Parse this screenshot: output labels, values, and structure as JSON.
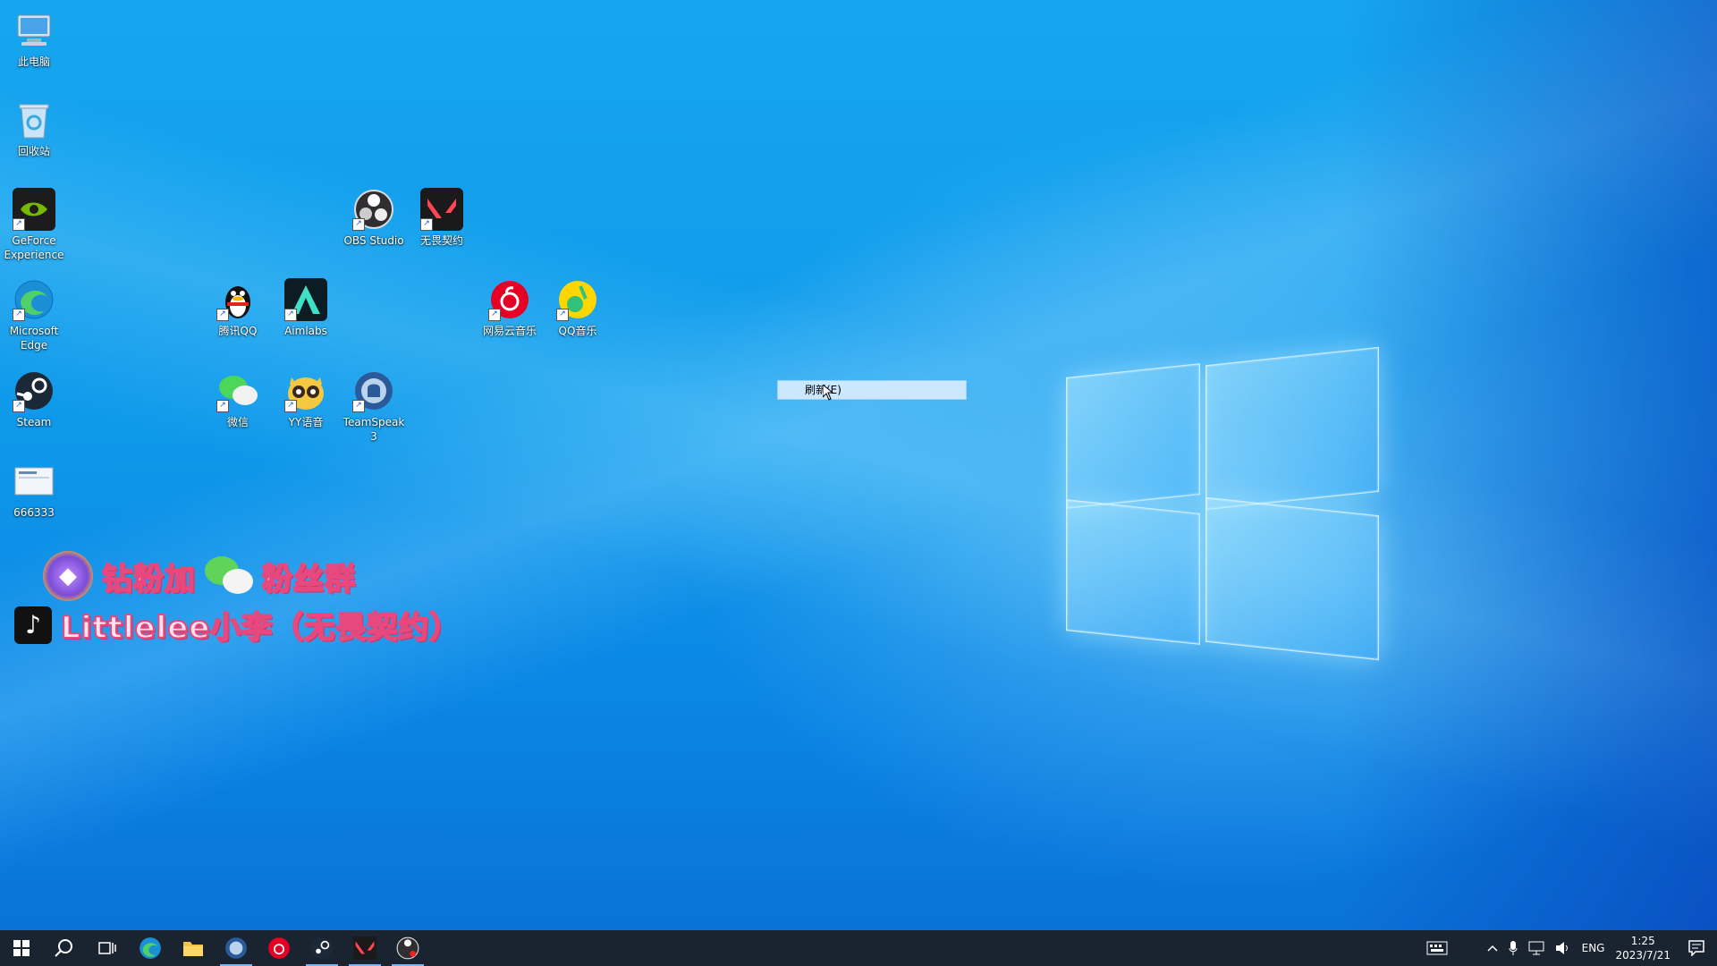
{
  "desktop": {
    "icons": [
      {
        "id": "this-pc",
        "label": "此电脑"
      },
      {
        "id": "recycle-bin",
        "label": "回收站"
      },
      {
        "id": "geforce",
        "label": "GeForce Experience"
      },
      {
        "id": "edge",
        "label": "Microsoft Edge"
      },
      {
        "id": "steam",
        "label": "Steam"
      },
      {
        "id": "file666333",
        "label": "666333"
      },
      {
        "id": "qq",
        "label": "腾讯QQ"
      },
      {
        "id": "aimlabs",
        "label": "Aimlabs"
      },
      {
        "id": "wechat",
        "label": "微信"
      },
      {
        "id": "yy",
        "label": "YY语音"
      },
      {
        "id": "obs",
        "label": "OBS Studio"
      },
      {
        "id": "teamspeak",
        "label": "TeamSpeak 3"
      },
      {
        "id": "valorant",
        "label": "无畏契约"
      },
      {
        "id": "netease-music",
        "label": "网易云音乐"
      },
      {
        "id": "qq-music",
        "label": "QQ音乐"
      }
    ]
  },
  "banner": {
    "line1_a": "钻粉加",
    "line1_b": "粉丝群",
    "line2": "Littlelee小李（无畏契约）"
  },
  "context_menu": {
    "item": "刷新(E)"
  },
  "taskbar": {
    "language": "ENG",
    "time": "1:25",
    "date": "2023/7/21"
  },
  "colors": {
    "taskbar_bg": "#1a2431",
    "menu_highlight": "#cce8ff",
    "banner_text": "#ffe3ef",
    "banner_stroke": "#e7487e"
  }
}
